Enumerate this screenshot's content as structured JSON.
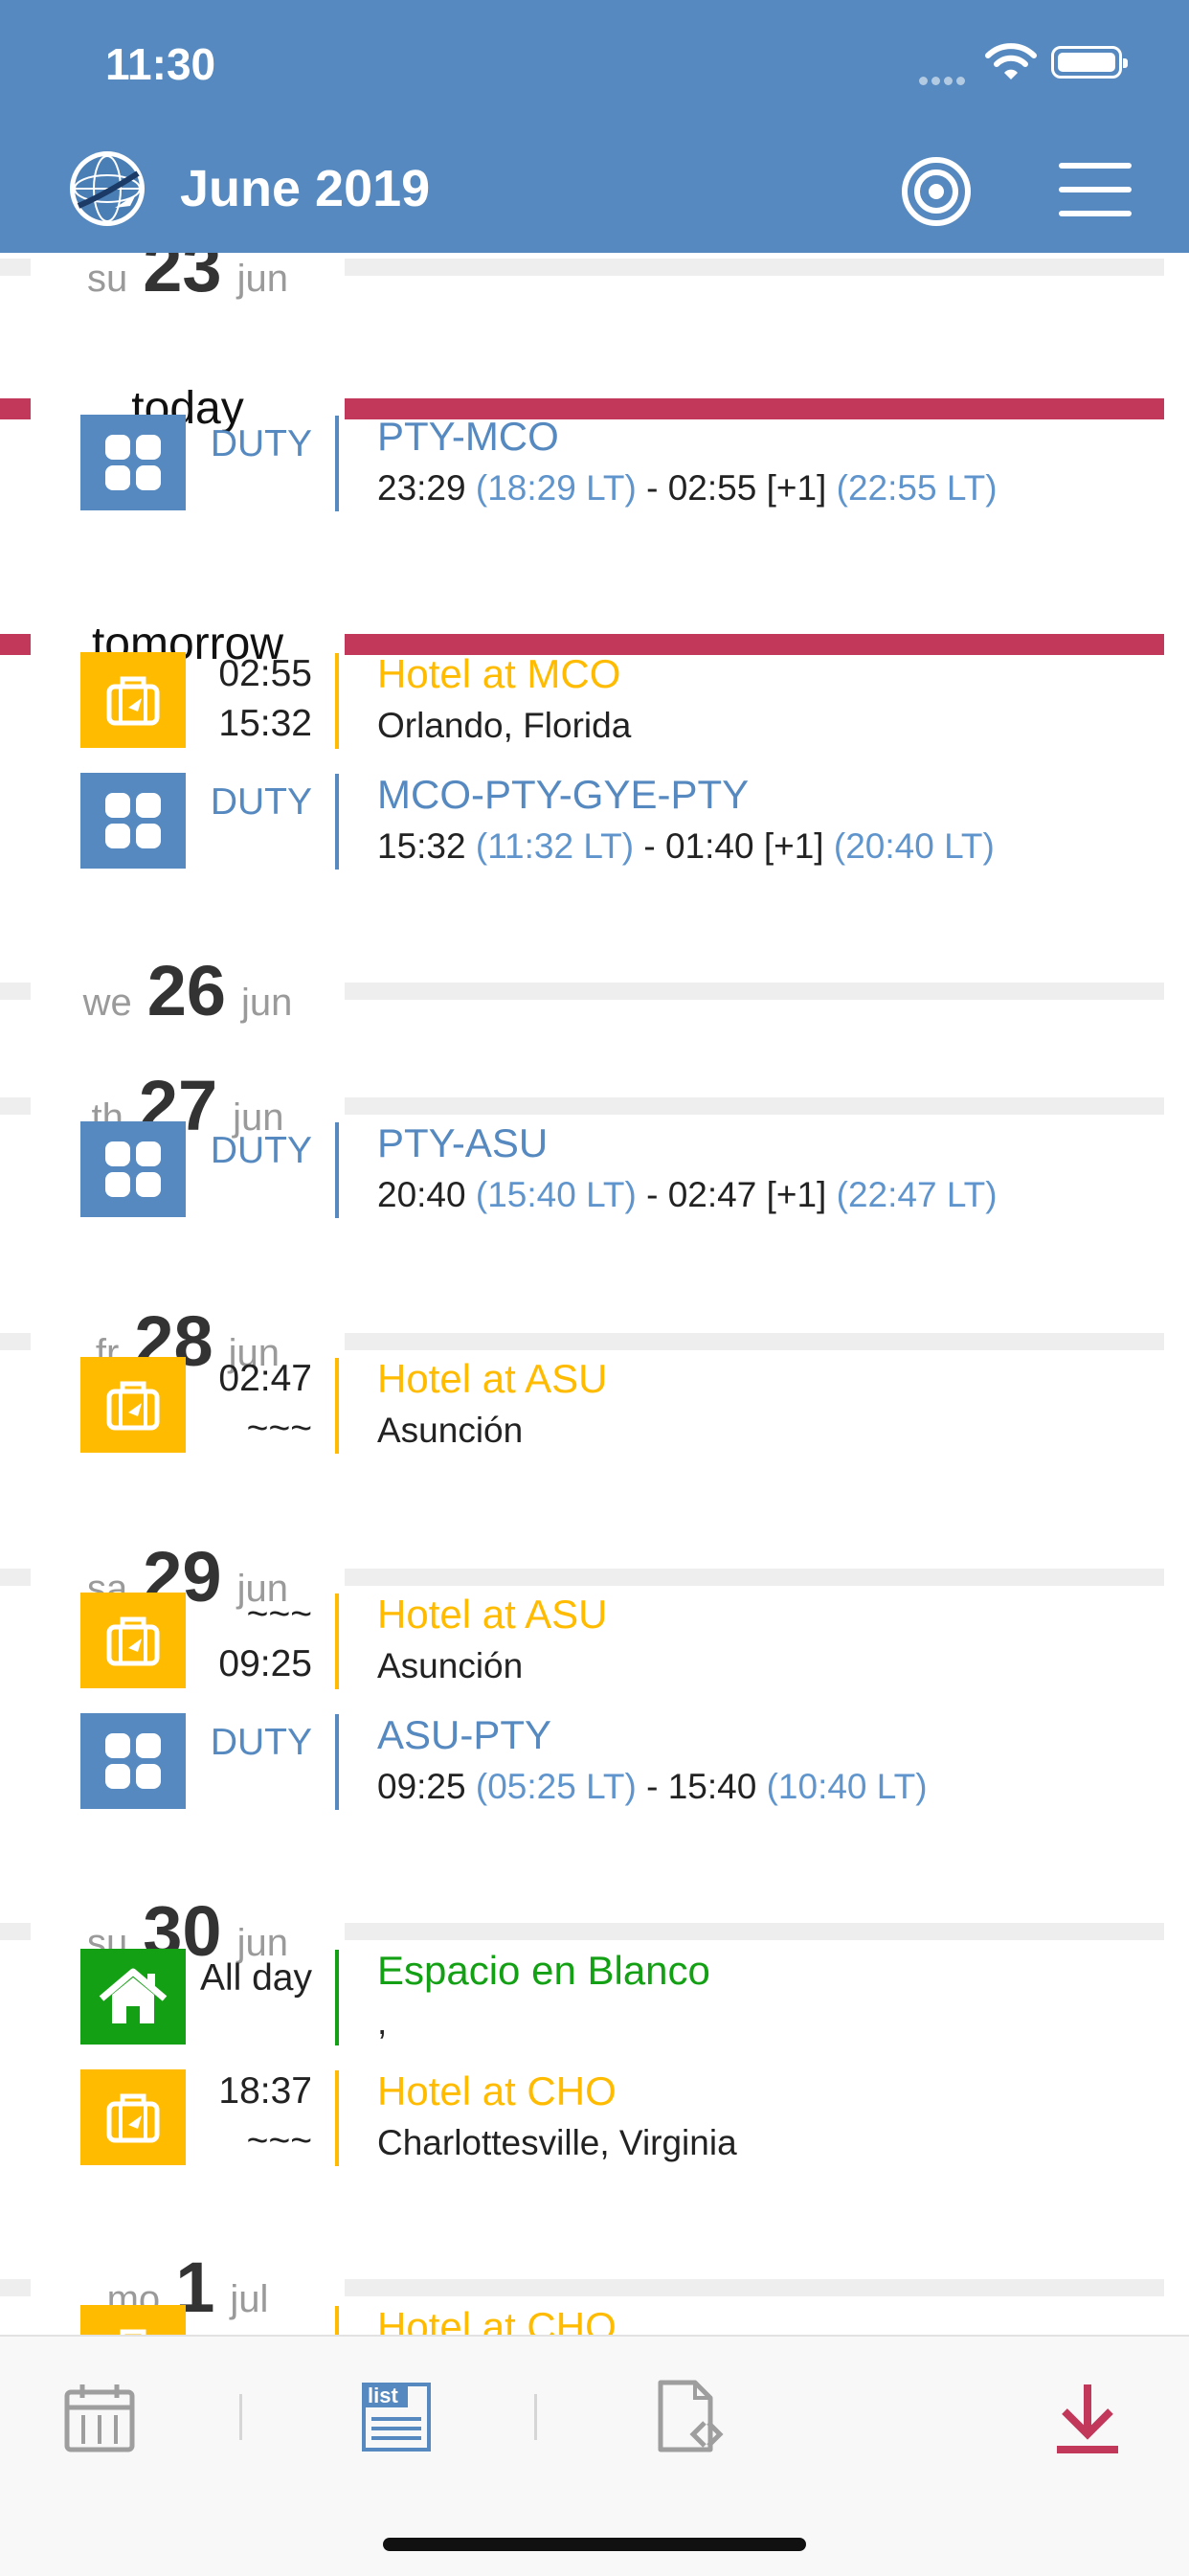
{
  "status": {
    "time": "11:30"
  },
  "header": {
    "title": "June 2019",
    "globe_icon": "globe-logo-icon",
    "target_icon": "target-icon",
    "menu_icon": "hamburger-menu-icon"
  },
  "colors": {
    "header": "#5589BF",
    "duty": "#5589BF",
    "hotel": "#FFBB00",
    "home": "#14A014",
    "today_line": "#C1385B"
  },
  "partial_day": {
    "abbr": "su",
    "num": "23",
    "mon": "jun"
  },
  "days": {
    "today": {
      "label": "today"
    },
    "tomorrow": {
      "label": "tomorrow"
    },
    "d26": {
      "abbr": "we",
      "num": "26",
      "mon": "jun"
    },
    "d27": {
      "abbr": "th",
      "num": "27",
      "mon": "jun"
    },
    "d28": {
      "abbr": "fr",
      "num": "28",
      "mon": "jun"
    },
    "d29": {
      "abbr": "sa",
      "num": "29",
      "mon": "jun"
    },
    "d30": {
      "abbr": "su",
      "num": "30",
      "mon": "jun"
    },
    "d1": {
      "abbr": "mo",
      "num": "1",
      "mon": "jul"
    }
  },
  "events": {
    "e1": {
      "time": "DUTY",
      "title": "PTY-MCO",
      "start": "23:29",
      "start_lt": "(18:29 LT)",
      "sep": "-",
      "end": "02:55 [+1]",
      "end_lt": "(22:55 LT)"
    },
    "e2": {
      "time1": "02:55",
      "time2": "15:32",
      "title": "Hotel at MCO",
      "sub": "Orlando, Florida"
    },
    "e3": {
      "time": "DUTY",
      "title": "MCO-PTY-GYE-PTY",
      "start": "15:32",
      "start_lt": "(11:32 LT)",
      "sep": "-",
      "end": "01:40 [+1]",
      "end_lt": "(20:40 LT)"
    },
    "e4": {
      "time": "DUTY",
      "title": "PTY-ASU",
      "start": "20:40",
      "start_lt": "(15:40 LT)",
      "sep": "-",
      "end": "02:47 [+1]",
      "end_lt": "(22:47 LT)"
    },
    "e5": {
      "time1": "02:47",
      "time2": "~~~",
      "title": "Hotel at ASU",
      "sub": "Asunción"
    },
    "e6": {
      "time1": "~~~",
      "time2": "09:25",
      "title": "Hotel at ASU",
      "sub": "Asunción"
    },
    "e7": {
      "time": "DUTY",
      "title": "ASU-PTY",
      "start": "09:25",
      "start_lt": "(05:25 LT)",
      "sep": "-",
      "end": "15:40",
      "end_lt": "(10:40 LT)"
    },
    "e8": {
      "time": "All day",
      "title": "Espacio en Blanco",
      "sub": ","
    },
    "e9": {
      "time1": "18:37",
      "time2": "~~~",
      "title": "Hotel at CHO",
      "sub": "Charlottesville, Virginia"
    },
    "e10": {
      "title": "Hotel at CHO"
    }
  },
  "tabbar": {
    "tabs": [
      "calendar-icon",
      "list-view-icon",
      "document-share-icon",
      "download-icon"
    ],
    "list_label": "list"
  }
}
